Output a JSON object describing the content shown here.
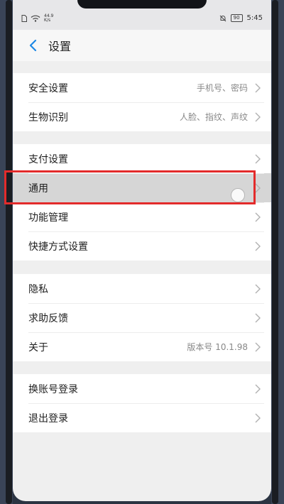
{
  "status_bar": {
    "speed_value": "44.9",
    "speed_unit": "K/s",
    "battery": "90",
    "time": "5:45"
  },
  "header": {
    "title": "设置"
  },
  "groups": [
    {
      "items": [
        {
          "label": "安全设置",
          "value": "手机号、密码"
        },
        {
          "label": "生物识别",
          "value": "人脸、指纹、声纹"
        }
      ]
    },
    {
      "items": [
        {
          "label": "支付设置",
          "value": ""
        },
        {
          "label": "通用",
          "value": "",
          "highlighted": true
        },
        {
          "label": "功能管理",
          "value": ""
        },
        {
          "label": "快捷方式设置",
          "value": ""
        }
      ]
    },
    {
      "items": [
        {
          "label": "隐私",
          "value": ""
        },
        {
          "label": "求助反馈",
          "value": ""
        },
        {
          "label": "关于",
          "value": "版本号 10.1.98"
        }
      ]
    },
    {
      "items": [
        {
          "label": "换账号登录",
          "value": ""
        },
        {
          "label": "退出登录",
          "value": ""
        }
      ]
    }
  ],
  "colors": {
    "highlight_border": "#e32b2b",
    "accent_back": "#1e88e5"
  }
}
